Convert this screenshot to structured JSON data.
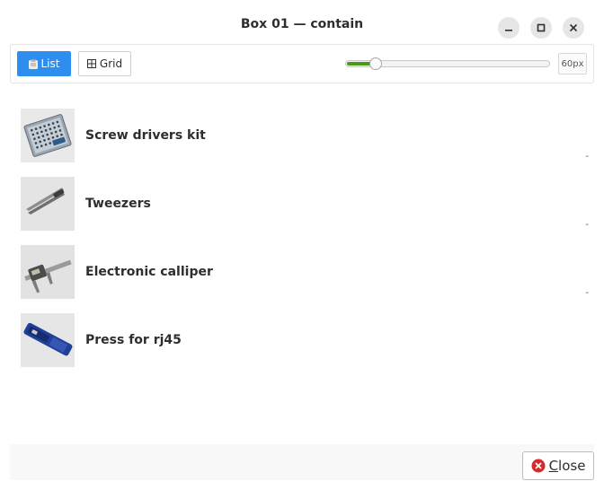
{
  "window": {
    "title": "Box 01 — contain",
    "buttons": {
      "minimize": "minimize-icon",
      "maximize": "maximize-icon",
      "close": "close-icon"
    }
  },
  "toolbar": {
    "list_label": "List",
    "grid_label": "Grid",
    "list_icon": "clipboard-icon",
    "grid_icon": "grid-icon",
    "slider_value_fraction": 0.15,
    "size_label": "60px",
    "accent": "#2d8ef0",
    "slider_color": "#4a9a18"
  },
  "items": [
    {
      "label": "Screw drivers kit",
      "marker": "-"
    },
    {
      "label": "Tweezers",
      "marker": "-"
    },
    {
      "label": "Electronic calliper",
      "marker": "-"
    },
    {
      "label": "Press for rj45",
      "marker": ""
    }
  ],
  "footer": {
    "close_first": "C",
    "close_rest": "lose",
    "close_icon": "close-circle-icon"
  }
}
